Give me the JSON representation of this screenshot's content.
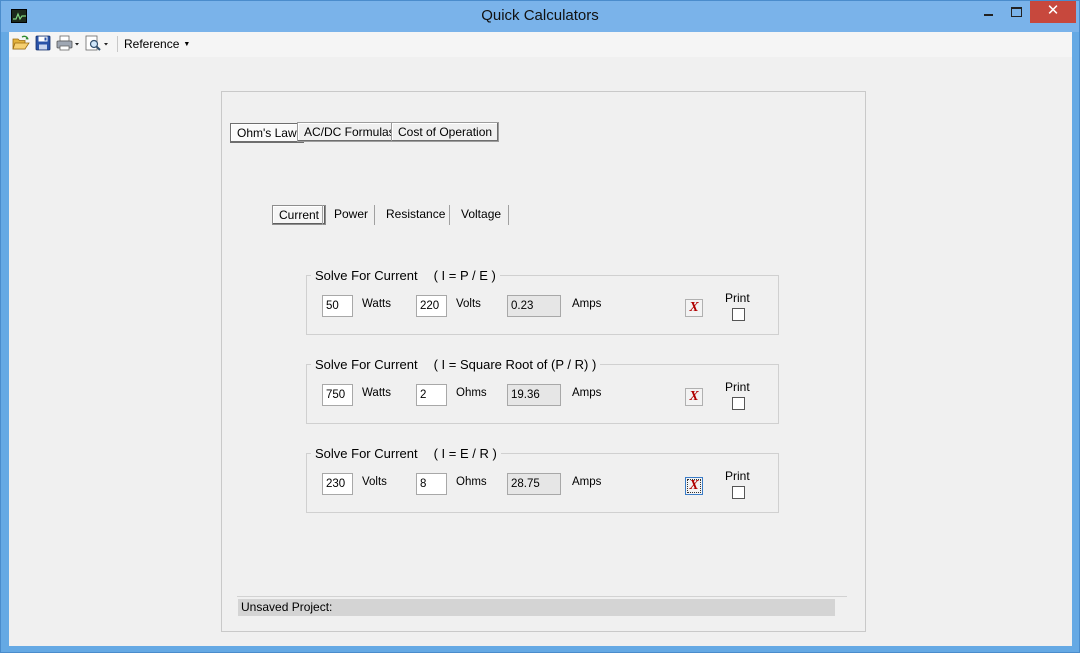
{
  "window": {
    "title": "Quick Calculators",
    "close_label": "✕"
  },
  "toolbar": {
    "reference_label": "Reference"
  },
  "main_tabs": [
    {
      "label": "Ohm's Law",
      "active": true
    },
    {
      "label": "AC/DC Formulas",
      "active": false
    },
    {
      "label": "Cost of Operation",
      "active": false
    }
  ],
  "sub_tabs": [
    {
      "label": "Current",
      "active": true
    },
    {
      "label": "Power",
      "active": false
    },
    {
      "label": "Resistance",
      "active": false
    },
    {
      "label": "Voltage",
      "active": false
    }
  ],
  "calculators": [
    {
      "title": "Solve For Current",
      "formula": "( I = P / E )",
      "input1": {
        "value": "50",
        "unit": "Watts"
      },
      "input2": {
        "value": "220",
        "unit": "Volts"
      },
      "result": {
        "value": "0.23",
        "unit": "Amps"
      },
      "clear_label": "X",
      "print_label": "Print"
    },
    {
      "title": "Solve For Current",
      "formula": "( I = Square Root of (P / R) )",
      "input1": {
        "value": "750",
        "unit": "Watts"
      },
      "input2": {
        "value": "2",
        "unit": "Ohms"
      },
      "result": {
        "value": "19.36",
        "unit": "Amps"
      },
      "clear_label": "X",
      "print_label": "Print"
    },
    {
      "title": "Solve For Current",
      "formula": "( I = E / R )",
      "input1": {
        "value": "230",
        "unit": "Volts"
      },
      "input2": {
        "value": "8",
        "unit": "Ohms"
      },
      "result": {
        "value": "28.75",
        "unit": "Amps"
      },
      "clear_label": "X",
      "print_label": "Print"
    }
  ],
  "status": {
    "text": "Unsaved Project:"
  }
}
